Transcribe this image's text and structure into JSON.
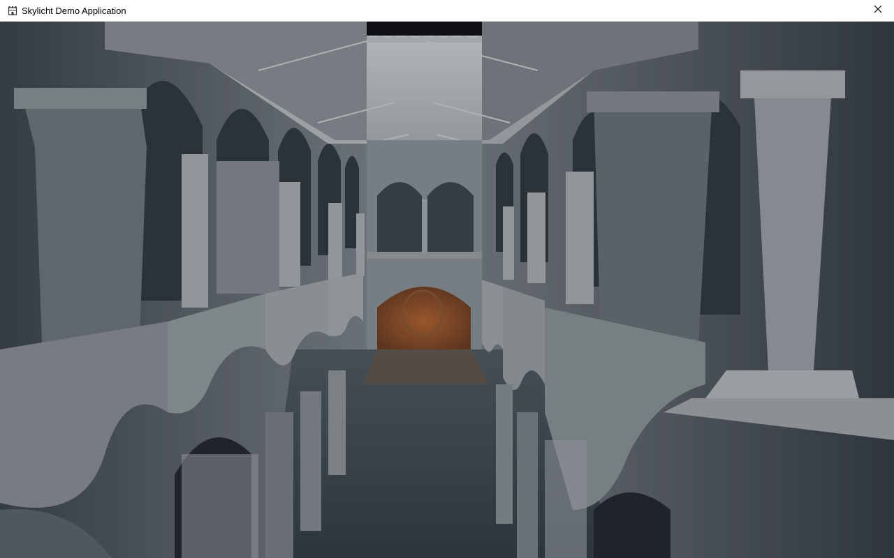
{
  "window": {
    "title": "Skylicht Demo Application",
    "app_icon": "castle-icon",
    "close_icon": "close-icon"
  },
  "colors": {
    "titlebar_bg": "#ffffff",
    "scene_dark": "#2a3239",
    "scene_light": "#c9ccce",
    "warm_light": "#b4632e"
  }
}
